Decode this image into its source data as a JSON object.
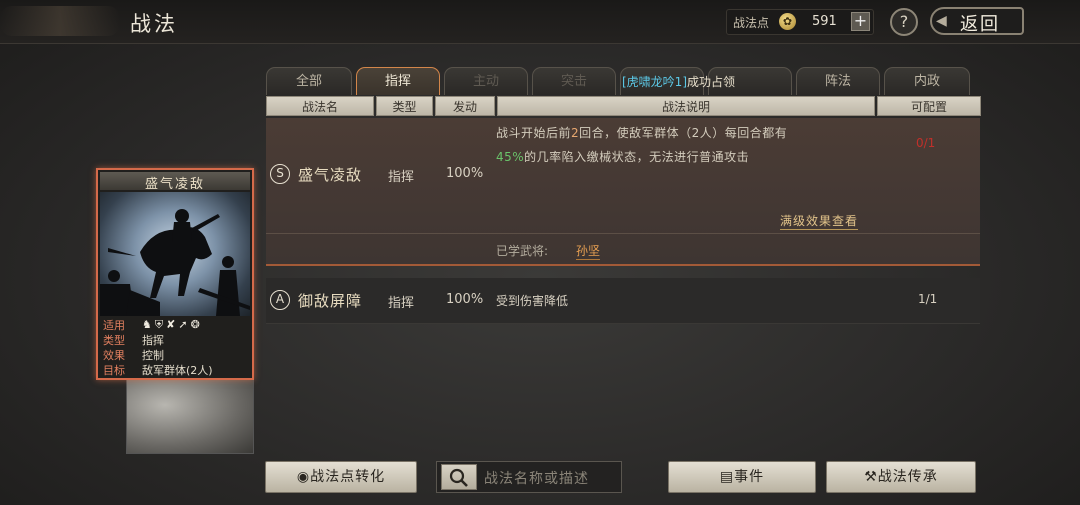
{
  "header": {
    "title": "战法",
    "points_label": "战法点",
    "points_value": "591",
    "plus": "+",
    "help": "?",
    "back": "返回"
  },
  "tabs": [
    {
      "label": "全部",
      "state": "normal"
    },
    {
      "label": "指挥",
      "state": "active"
    },
    {
      "label": "主动",
      "state": "dim"
    },
    {
      "label": "突击",
      "state": "dim"
    },
    {
      "label": "",
      "state": "dim"
    },
    {
      "label": "",
      "state": "dim"
    },
    {
      "label": "阵法",
      "state": "normal"
    },
    {
      "label": "内政",
      "state": "normal"
    }
  ],
  "marquee": {
    "highlight": "[虎啸龙吟1]",
    "text": "成功占领"
  },
  "columns": [
    "战法名",
    "类型",
    "发动",
    "战法说明",
    "可配置"
  ],
  "skills": [
    {
      "grade": "S",
      "name": "盛气凌敌",
      "type": "指挥",
      "rate": "100%",
      "desc_a": "战斗开始后前",
      "desc_num": "2",
      "desc_b": "回合，使敌军群体（2人）每回合都有",
      "desc_pct": "45%",
      "desc_c": "的几率陷入缴械状态，无法进行普通攻击",
      "ratio": "0/1",
      "full_effect": "满级效果查看",
      "learned_label": "已学武将:",
      "learned_name": "孙坚"
    },
    {
      "grade": "A",
      "name": "御敌屏障",
      "type": "指挥",
      "rate": "100%",
      "desc": "受到伤害降低",
      "ratio": "1/1"
    }
  ],
  "card": {
    "title": "盛气凌敌",
    "rows": [
      {
        "k": "适用",
        "v": ""
      },
      {
        "k": "类型",
        "v": "指挥"
      },
      {
        "k": "效果",
        "v": "控制"
      },
      {
        "k": "目标",
        "v": "敌军群体(2人)"
      }
    ],
    "unit_icons": [
      "cavalry-icon",
      "shield-icon",
      "bow-icon",
      "spear-icon",
      "wheel-icon"
    ]
  },
  "bottom": {
    "convert": "战法点转化",
    "search_placeholder": "战法名称或描述",
    "event": "事件",
    "inherit": "战法传承"
  },
  "colors": {
    "accent": "#d3864a",
    "active_border": "#d56a4a",
    "green_value": "#6ac26a",
    "learned_orange": "#e8a052",
    "ratio_red": "#c0302a"
  }
}
